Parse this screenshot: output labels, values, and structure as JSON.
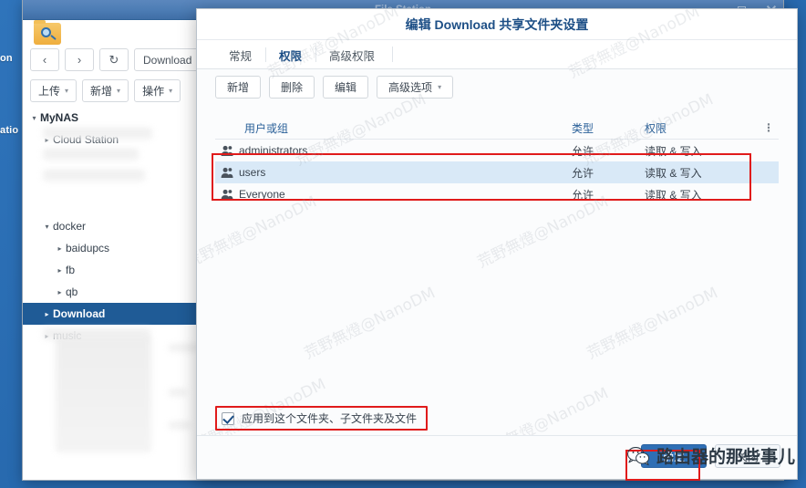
{
  "desktop": {
    "labels": [
      "on",
      "atio"
    ]
  },
  "file_station": {
    "title": "File Station",
    "window_controls": [
      "minimize-icon",
      "maximize-icon",
      "close-icon"
    ],
    "app_icon": "file-station-icon",
    "nav": {
      "back": "‹",
      "forward": "›",
      "refresh": "↻",
      "path_value": "Download"
    },
    "toolbar": [
      {
        "label": "上传",
        "caret": "▾"
      },
      {
        "label": "新增",
        "caret": "▾"
      },
      {
        "label": "操作",
        "caret": "▾"
      }
    ],
    "tree": [
      {
        "label": "MyNAS",
        "level": 0,
        "arrow": "▾",
        "selected": false,
        "root": true
      },
      {
        "label": "Cloud Station",
        "level": 1,
        "arrow": "▸",
        "selected": false,
        "root": false
      },
      {
        "label": "docker",
        "level": 1,
        "arrow": "▾",
        "selected": false,
        "root": false
      },
      {
        "label": "baidupcs",
        "level": 2,
        "arrow": "▸",
        "selected": false,
        "root": false
      },
      {
        "label": "fb",
        "level": 2,
        "arrow": "▸",
        "selected": false,
        "root": false
      },
      {
        "label": "qb",
        "level": 2,
        "arrow": "▸",
        "selected": false,
        "root": false
      },
      {
        "label": "Download",
        "level": 1,
        "arrow": "▸",
        "selected": true,
        "root": false
      },
      {
        "label": "music",
        "level": 1,
        "arrow": "▸",
        "selected": false,
        "root": false
      }
    ]
  },
  "dialog": {
    "title": "编辑 Download 共享文件夹设置",
    "tabs": [
      {
        "label": "常规",
        "active": false
      },
      {
        "label": "权限",
        "active": true
      },
      {
        "label": "高级权限",
        "active": false
      }
    ],
    "toolbar": [
      {
        "label": "新增",
        "caret": ""
      },
      {
        "label": "删除",
        "caret": ""
      },
      {
        "label": "编辑",
        "caret": ""
      },
      {
        "label": "高级选项",
        "caret": "▾"
      }
    ],
    "table": {
      "headers": {
        "name": "用户或组",
        "type": "类型",
        "permission": "权限",
        "menu": "⋮"
      },
      "rows": [
        {
          "icon": "user-group-icon",
          "name": "administrators",
          "type": "允许",
          "permission": "读取 & 写入",
          "selected": false
        },
        {
          "icon": "user-group-icon",
          "name": "users",
          "type": "允许",
          "permission": "读取 & 写入",
          "selected": true
        },
        {
          "icon": "user-group-icon",
          "name": "Everyone",
          "type": "允许",
          "permission": "读取 & 写入",
          "selected": false
        }
      ]
    },
    "apply_checkbox": {
      "checked": true,
      "label": "应用到这个文件夹、子文件夹及文件"
    },
    "footer": {
      "ok": "确定",
      "cancel": "关闭"
    }
  },
  "watermark": {
    "text": "荒野無燈@NanoDM",
    "wechat_text": "路由器的那些事儿",
    "wechat_icon": "wechat-icon"
  },
  "colors": {
    "accent": "#1b4d85",
    "desktop": "#2a6db5",
    "highlight_red": "#e01b1b",
    "row_selected": "#d9e9f7",
    "tree_selected": "#1f5b96",
    "ok_button": "#2f6fb5"
  }
}
